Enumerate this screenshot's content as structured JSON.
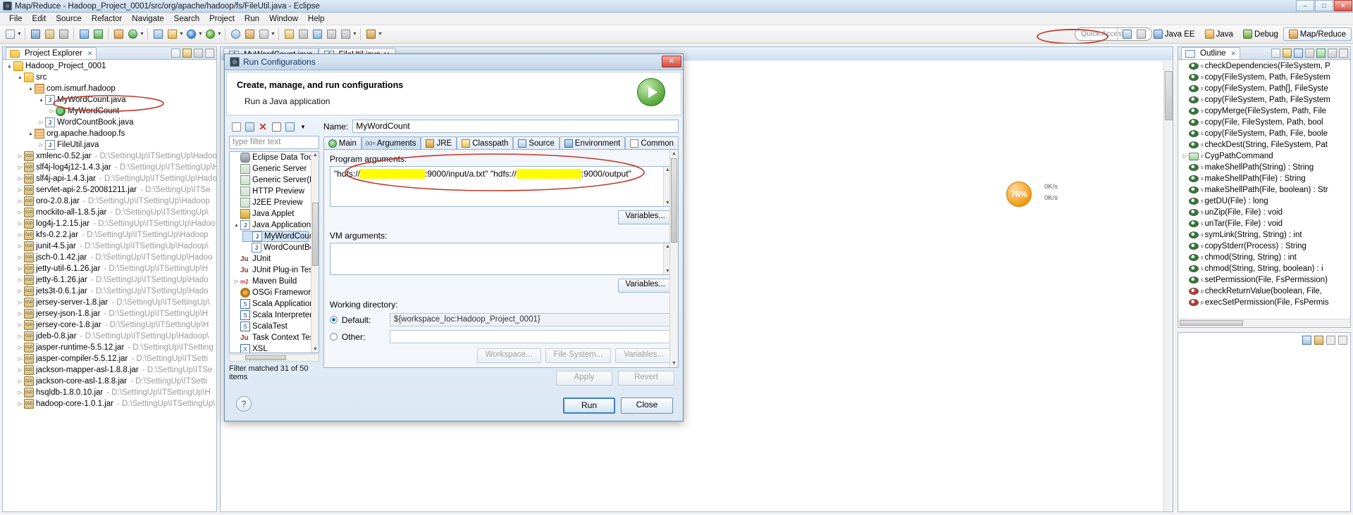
{
  "window": {
    "title": "Map/Reduce - Hadoop_Project_0001/src/org/apache/hadoop/fs/FileUtil.java - Eclipse",
    "minimize": "–",
    "maximize": "□",
    "close": "✕"
  },
  "menubar": {
    "items": [
      "File",
      "Edit",
      "Source",
      "Refactor",
      "Navigate",
      "Search",
      "Project",
      "Run",
      "Window",
      "Help"
    ]
  },
  "toolbar": {
    "quick_access_placeholder": "Quick Access",
    "perspectives": [
      {
        "label": "Java EE",
        "active": false
      },
      {
        "label": "Java",
        "active": false
      },
      {
        "label": "Debug",
        "active": false
      },
      {
        "label": "Map/Reduce",
        "active": true
      }
    ]
  },
  "project_explorer": {
    "tab_label": "Project Explorer",
    "close_icon": "✕",
    "tree": [
      {
        "indent": 0,
        "twisty": "▲",
        "icon": "folder",
        "label": "Hadoop_Project_0001",
        "path": ""
      },
      {
        "indent": 1,
        "twisty": "▲",
        "icon": "folder",
        "label": "src",
        "path": ""
      },
      {
        "indent": 2,
        "twisty": "▲",
        "icon": "pkg",
        "label": "com.ismurf.hadoop",
        "path": ""
      },
      {
        "indent": 3,
        "twisty": "▲",
        "icon": "java",
        "label": "MyWordCount.java",
        "path": "",
        "circled": true
      },
      {
        "indent": 4,
        "twisty": "▷",
        "icon": "class",
        "label": "MyWordCount",
        "path": ""
      },
      {
        "indent": 3,
        "twisty": "▷",
        "icon": "java",
        "label": "WordCountBook.java",
        "path": ""
      },
      {
        "indent": 2,
        "twisty": "▲",
        "icon": "pkg",
        "label": "org.apache.hadoop.fs",
        "path": ""
      },
      {
        "indent": 3,
        "twisty": "▷",
        "icon": "java",
        "label": "FileUtil.java",
        "path": ""
      },
      {
        "indent": 1,
        "twisty": "▷",
        "icon": "jar",
        "label": "xmlenc-0.52.jar",
        "path": "- D:\\SettingUp\\ITSettingUp\\Hadoo"
      },
      {
        "indent": 1,
        "twisty": "▷",
        "icon": "jar",
        "label": "slf4j-log4j12-1.4.3.jar",
        "path": "- D:\\SettingUp\\ITSettingUp\\Hado"
      },
      {
        "indent": 1,
        "twisty": "▷",
        "icon": "jar",
        "label": "slf4j-api-1.4.3.jar",
        "path": "- D:\\SettingUp\\ITSettingUp\\Hadoo"
      },
      {
        "indent": 1,
        "twisty": "▷",
        "icon": "jar",
        "label": "servlet-api-2.5-20081211.jar",
        "path": "- D:\\SettingUp\\ITSe"
      },
      {
        "indent": 1,
        "twisty": "▷",
        "icon": "jar",
        "label": "oro-2.0.8.jar",
        "path": "- D:\\SettingUp\\ITSettingUp\\Hadoop"
      },
      {
        "indent": 1,
        "twisty": "▷",
        "icon": "jar",
        "label": "mockito-all-1.8.5.jar",
        "path": "- D:\\SettingUp\\ITSettingUp\\"
      },
      {
        "indent": 1,
        "twisty": "▷",
        "icon": "jar",
        "label": "log4j-1.2.15.jar",
        "path": "- D:\\SettingUp\\ITSettingUp\\Hadoo"
      },
      {
        "indent": 1,
        "twisty": "▷",
        "icon": "jar",
        "label": "kfs-0.2.2.jar",
        "path": "- D:\\SettingUp\\ITSettingUp\\Hadoop"
      },
      {
        "indent": 1,
        "twisty": "▷",
        "icon": "jar",
        "label": "junit-4.5.jar",
        "path": "- D:\\SettingUp\\ITSettingUp\\Hadoop\\"
      },
      {
        "indent": 1,
        "twisty": "▷",
        "icon": "jar",
        "label": "jsch-0.1.42.jar",
        "path": "- D:\\SettingUp\\ITSettingUp\\Hadoo"
      },
      {
        "indent": 1,
        "twisty": "▷",
        "icon": "jar",
        "label": "jetty-util-6.1.26.jar",
        "path": "- D:\\SettingUp\\ITSettingUp\\H"
      },
      {
        "indent": 1,
        "twisty": "▷",
        "icon": "jar",
        "label": "jetty-6.1.26.jar",
        "path": "- D:\\SettingUp\\ITSettingUp\\Hado"
      },
      {
        "indent": 1,
        "twisty": "▷",
        "icon": "jar",
        "label": "jets3t-0.6.1.jar",
        "path": "- D:\\SettingUp\\ITSettingUp\\Hado"
      },
      {
        "indent": 1,
        "twisty": "▷",
        "icon": "jar",
        "label": "jersey-server-1.8.jar",
        "path": "- D:\\SettingUp\\ITSettingUp\\"
      },
      {
        "indent": 1,
        "twisty": "▷",
        "icon": "jar",
        "label": "jersey-json-1.8.jar",
        "path": "- D:\\SettingUp\\ITSettingUp\\H"
      },
      {
        "indent": 1,
        "twisty": "▷",
        "icon": "jar",
        "label": "jersey-core-1.8.jar",
        "path": "- D:\\SettingUp\\ITSettingUp\\H"
      },
      {
        "indent": 1,
        "twisty": "▷",
        "icon": "jar",
        "label": "jdeb-0.8.jar",
        "path": "- D:\\SettingUp\\ITSettingUp\\Hadoop\\"
      },
      {
        "indent": 1,
        "twisty": "▷",
        "icon": "jar",
        "label": "jasper-runtime-5.5.12.jar",
        "path": "- D:\\SettingUp\\ITSetting"
      },
      {
        "indent": 1,
        "twisty": "▷",
        "icon": "jar",
        "label": "jasper-compiler-5.5.12.jar",
        "path": "- D:\\SettingUp\\ITSetti"
      },
      {
        "indent": 1,
        "twisty": "▷",
        "icon": "jar",
        "label": "jackson-mapper-asl-1.8.8.jar",
        "path": "- D:\\SettingUp\\ITSe"
      },
      {
        "indent": 1,
        "twisty": "▷",
        "icon": "jar",
        "label": "jackson-core-asl-1.8.8.jar",
        "path": "- D:\\SettingUp\\ITSetti"
      },
      {
        "indent": 1,
        "twisty": "▷",
        "icon": "jar",
        "label": "hsqldb-1.8.0.10.jar",
        "path": "- D:\\SettingUp\\ITSettingUp\\H"
      },
      {
        "indent": 1,
        "twisty": "▷",
        "icon": "jar",
        "label": "hadoop-core-1.0.1.jar",
        "path": "- D:\\SettingUp\\ITSettingUp\\"
      }
    ]
  },
  "editor": {
    "tabs": [
      {
        "label": "MyWordCount.java",
        "active": false
      },
      {
        "label": "FileUtil.java",
        "active": true,
        "close_icon": "✕"
      }
    ]
  },
  "outline": {
    "tab_label": "Outline",
    "close_icon": "✕",
    "items": [
      {
        "kind": "method",
        "vis": "s",
        "label": "checkDependencies(FileSystem, P"
      },
      {
        "kind": "method",
        "vis": "s",
        "label": "copy(FileSystem, Path, FileSystem"
      },
      {
        "kind": "method",
        "vis": "s",
        "label": "copy(FileSystem, Path[], FileSyste"
      },
      {
        "kind": "method",
        "vis": "s",
        "label": "copy(FileSystem, Path, FileSystem"
      },
      {
        "kind": "method",
        "vis": "s",
        "label": "copyMerge(FileSystem, Path, File"
      },
      {
        "kind": "method",
        "vis": "s",
        "label": "copy(File, FileSystem, Path, bool"
      },
      {
        "kind": "method",
        "vis": "s",
        "label": "copy(FileSystem, Path, File, boole"
      },
      {
        "kind": "method",
        "vis": "s",
        "label": "checkDest(String, FileSystem, Pat"
      },
      {
        "kind": "class",
        "vis": "c",
        "label": "CygPathCommand",
        "twisty": "▷"
      },
      {
        "kind": "method",
        "vis": "s",
        "label": "makeShellPath(String) : String"
      },
      {
        "kind": "method",
        "vis": "s",
        "label": "makeShellPath(File) : String"
      },
      {
        "kind": "method",
        "vis": "s",
        "label": "makeShellPath(File, boolean) : Str"
      },
      {
        "kind": "method",
        "vis": "s",
        "label": "getDU(File) : long"
      },
      {
        "kind": "method",
        "vis": "s",
        "label": "unZip(File, File) : void"
      },
      {
        "kind": "method",
        "vis": "s",
        "label": "unTar(File, File) : void"
      },
      {
        "kind": "method",
        "vis": "s",
        "label": "symLink(String, String) : int"
      },
      {
        "kind": "method",
        "vis": "s",
        "label": "copyStderr(Process) : String"
      },
      {
        "kind": "method",
        "vis": "s",
        "label": "chmod(String, String) : int"
      },
      {
        "kind": "method",
        "vis": "s",
        "label": "chmod(String, String, boolean) : i"
      },
      {
        "kind": "method",
        "vis": "s",
        "label": "setPermission(File, FsPermission)"
      },
      {
        "kind": "method",
        "vis": "p",
        "label": "checkReturnValue(boolean, File,"
      },
      {
        "kind": "method",
        "vis": "p",
        "label": "execSetPermission(File, FsPermis"
      }
    ]
  },
  "progress_badge": {
    "percent": "76%",
    "rates": [
      "0K/s",
      "0K/s"
    ]
  },
  "dialog": {
    "title": "Run Configurations",
    "close_icon": "✕",
    "header_title": "Create, manage, and run configurations",
    "header_subtitle": "Run a Java application",
    "filter_placeholder": "type filter text",
    "match_text": "Filter matched 31 of 50 items",
    "left_toolbar_icons": [
      "new-config-icon",
      "duplicate-icon",
      "delete-icon",
      "collapse-all-icon",
      "filter-icon",
      "dropdown-arrow-icon"
    ],
    "config_tree": [
      {
        "indent": 0,
        "twisty": "",
        "icon": "dbtools",
        "label": "Eclipse Data Tools",
        "selected": false
      },
      {
        "indent": 0,
        "twisty": "",
        "icon": "server",
        "label": "Generic Server",
        "selected": false
      },
      {
        "indent": 0,
        "twisty": "",
        "icon": "server",
        "label": "Generic Server(Exte",
        "selected": false
      },
      {
        "indent": 0,
        "twisty": "",
        "icon": "server",
        "label": "HTTP Preview",
        "selected": false
      },
      {
        "indent": 0,
        "twisty": "",
        "icon": "server",
        "label": "J2EE Preview",
        "selected": false
      },
      {
        "indent": 0,
        "twisty": "",
        "icon": "applet",
        "label": "Java Applet",
        "selected": false
      },
      {
        "indent": 0,
        "twisty": "▲",
        "icon": "java",
        "label": "Java Application",
        "selected": false
      },
      {
        "indent": 1,
        "twisty": "",
        "icon": "java",
        "label": "MyWordCount",
        "selected": true
      },
      {
        "indent": 1,
        "twisty": "",
        "icon": "java",
        "label": "WordCountBoo",
        "selected": false
      },
      {
        "indent": 0,
        "twisty": "",
        "icon": "junit",
        "label": "JUnit",
        "selected": false
      },
      {
        "indent": 0,
        "twisty": "",
        "icon": "junit",
        "label": "JUnit Plug-in Test",
        "selected": false
      },
      {
        "indent": 0,
        "twisty": "▷",
        "icon": "m2",
        "label": "Maven Build",
        "selected": false
      },
      {
        "indent": 0,
        "twisty": "",
        "icon": "osgi",
        "label": "OSGi Framework",
        "selected": false
      },
      {
        "indent": 0,
        "twisty": "",
        "icon": "scala",
        "label": "Scala Application",
        "selected": false
      },
      {
        "indent": 0,
        "twisty": "",
        "icon": "scala",
        "label": "Scala Interpreter",
        "selected": false
      },
      {
        "indent": 0,
        "twisty": "",
        "icon": "scala",
        "label": "ScalaTest",
        "selected": false
      },
      {
        "indent": 0,
        "twisty": "",
        "icon": "junit",
        "label": "Task Context Test",
        "selected": false
      },
      {
        "indent": 0,
        "twisty": "",
        "icon": "xsl",
        "label": "XSL",
        "selected": false
      }
    ],
    "name_label": "Name:",
    "name_value": "MyWordCount",
    "tabs": [
      {
        "label": "Main",
        "icon": "main-icon",
        "active": false
      },
      {
        "label": "Arguments",
        "icon": "arguments-icon",
        "active": true
      },
      {
        "label": "JRE",
        "icon": "jre-icon",
        "active": false
      },
      {
        "label": "Classpath",
        "icon": "classpath-icon",
        "active": false
      },
      {
        "label": "Source",
        "icon": "source-icon",
        "active": false
      },
      {
        "label": "Environment",
        "icon": "environment-icon",
        "active": false
      },
      {
        "label": "Common",
        "icon": "common-icon",
        "active": false
      }
    ],
    "program_arguments_label": "Program arguments:",
    "program_arguments_prefix": "\"hdfs://",
    "program_arguments_redacted_1": "",
    "program_arguments_mid": ":9000/input/a.txt\"  \"hdfs://",
    "program_arguments_redacted_2": "",
    "program_arguments_suffix": ":9000/output\"",
    "vm_arguments_label": "VM arguments:",
    "vm_arguments_value": "",
    "variables_button_1": "Variables...",
    "variables_button_2": "Variables...",
    "working_directory_label": "Working directory:",
    "default_radio_label": "Default:",
    "default_value": "${workspace_loc:Hadoop_Project_0001}",
    "other_radio_label": "Other:",
    "other_value": "",
    "workspace_button": "Workspace...",
    "filesystem_button": "File System...",
    "variables_button_3": "Variables...",
    "apply_button": "Apply",
    "revert_button": "Revert",
    "help_icon": "?",
    "run_button": "Run",
    "close_button": "Close"
  }
}
